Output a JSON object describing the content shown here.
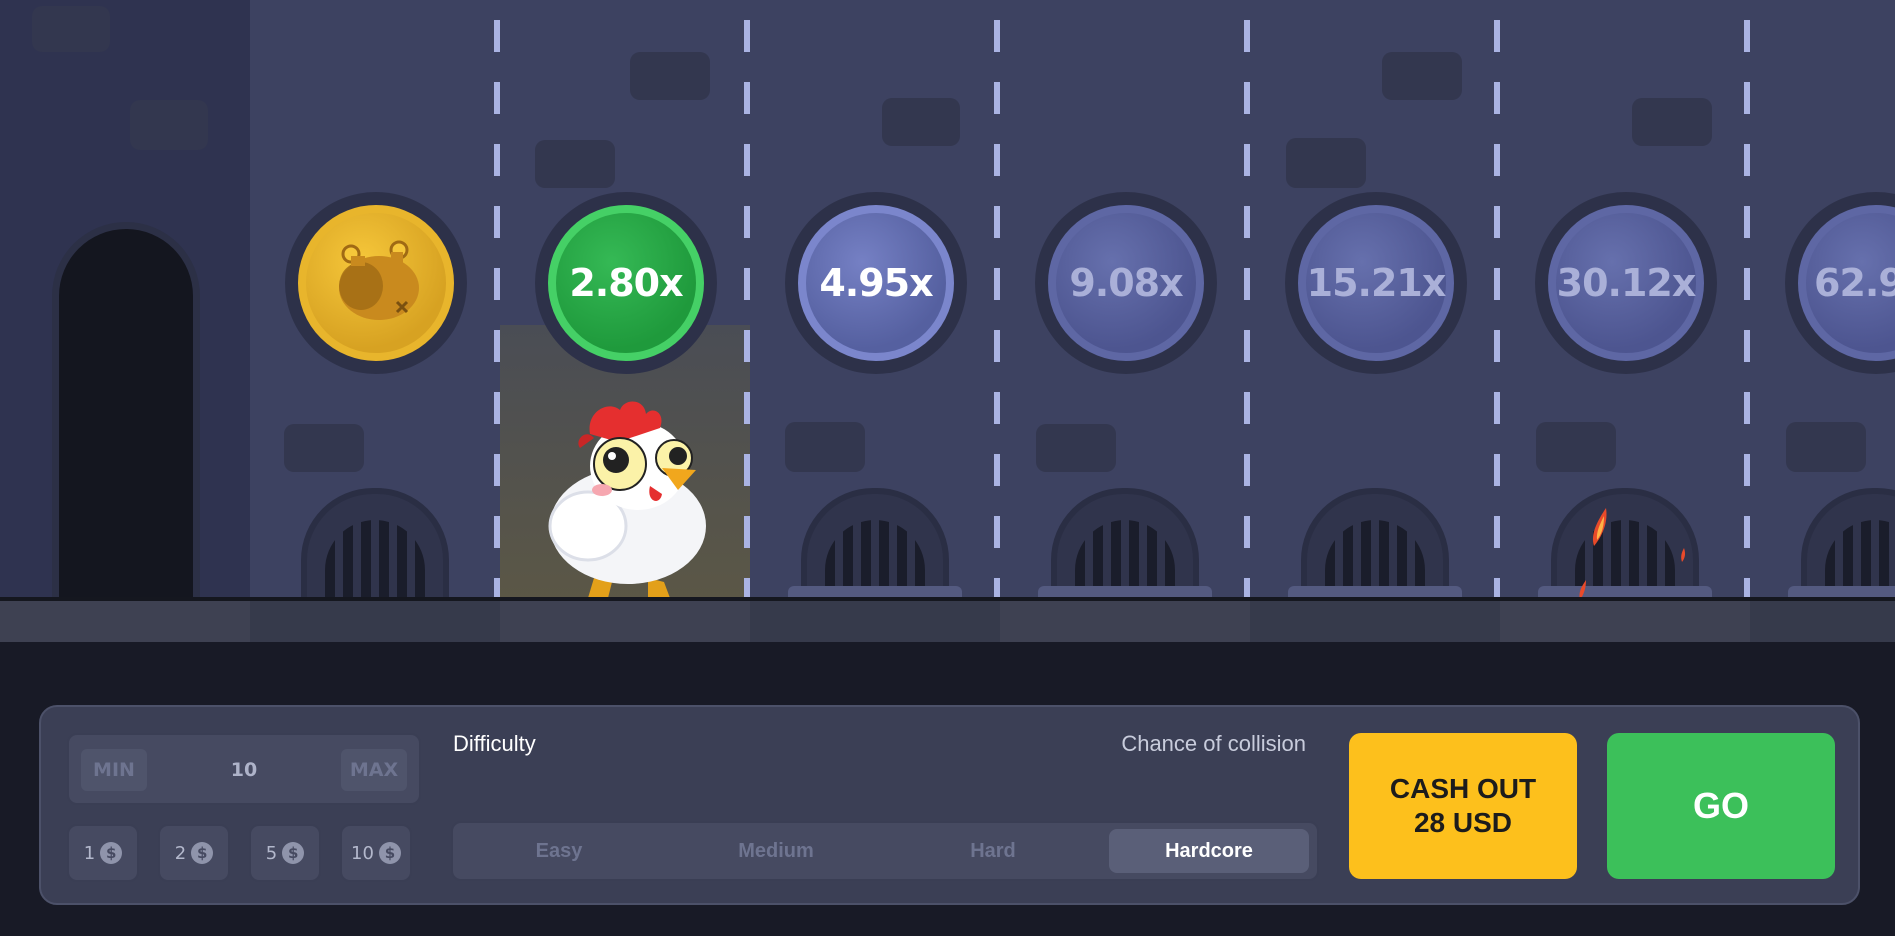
{
  "game": {
    "multipliers": [
      {
        "state": "collected",
        "icon": "roasted-chicken-icon"
      },
      {
        "state": "current",
        "label": "2.80x"
      },
      {
        "state": "next",
        "label": "4.95x"
      },
      {
        "state": "locked",
        "label": "9.08x"
      },
      {
        "state": "locked",
        "label": "15.21x"
      },
      {
        "state": "locked",
        "label": "30.12x"
      },
      {
        "state": "locked",
        "label": "62.9"
      }
    ],
    "colors": {
      "gold": "#f6c73a",
      "green": "#35b955",
      "blue": "#5e67a4",
      "wall": "#3d4261"
    }
  },
  "bet": {
    "min_label": "MIN",
    "value": "10",
    "max_label": "MAX",
    "chips": [
      {
        "amount": "1",
        "icon": "$"
      },
      {
        "amount": "2",
        "icon": "$"
      },
      {
        "amount": "5",
        "icon": "$"
      },
      {
        "amount": "10",
        "icon": "$"
      }
    ]
  },
  "difficulty": {
    "label": "Difficulty",
    "chance_label": "Chance of collision",
    "options": [
      "Easy",
      "Medium",
      "Hard",
      "Hardcore"
    ],
    "selected": "Hardcore"
  },
  "actions": {
    "cashout_line1": "CASH OUT",
    "cashout_line2": "28 USD",
    "go_label": "GO"
  }
}
